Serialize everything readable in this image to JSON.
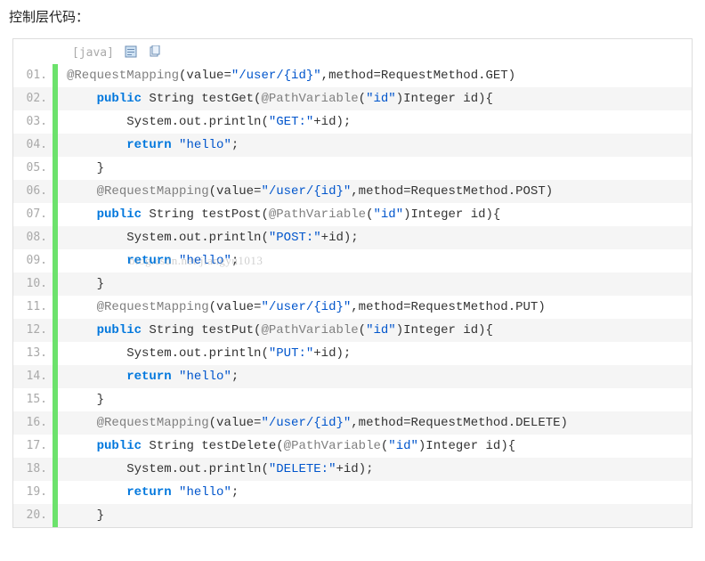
{
  "title": "控制层代码：",
  "header": {
    "lang_label": "[java]"
  },
  "watermark": "blog.csdn.net/jiangyu1013",
  "lines": [
    {
      "n": "01.",
      "indent": 0,
      "tokens": [
        {
          "c": "an",
          "t": "@RequestMapping"
        },
        {
          "c": "pl",
          "t": "(value="
        },
        {
          "c": "str",
          "t": "\"/user/{id}\""
        },
        {
          "c": "pl",
          "t": ",method=RequestMethod.GET)"
        }
      ]
    },
    {
      "n": "02.",
      "indent": 1,
      "tokens": [
        {
          "c": "kw",
          "t": "public"
        },
        {
          "c": "pl",
          "t": " String testGet("
        },
        {
          "c": "an",
          "t": "@PathVariable"
        },
        {
          "c": "pl",
          "t": "("
        },
        {
          "c": "str",
          "t": "\"id\""
        },
        {
          "c": "pl",
          "t": ")Integer id){"
        }
      ]
    },
    {
      "n": "03.",
      "indent": 2,
      "tokens": [
        {
          "c": "pl",
          "t": "System.out.println("
        },
        {
          "c": "str",
          "t": "\"GET:\""
        },
        {
          "c": "pl",
          "t": "+id);"
        }
      ]
    },
    {
      "n": "04.",
      "indent": 2,
      "tokens": [
        {
          "c": "kw",
          "t": "return"
        },
        {
          "c": "pl",
          "t": " "
        },
        {
          "c": "str",
          "t": "\"hello\""
        },
        {
          "c": "pl",
          "t": ";"
        }
      ]
    },
    {
      "n": "05.",
      "indent": 1,
      "tokens": [
        {
          "c": "pl",
          "t": "}"
        }
      ]
    },
    {
      "n": "06.",
      "indent": 1,
      "tokens": [
        {
          "c": "an",
          "t": "@RequestMapping"
        },
        {
          "c": "pl",
          "t": "(value="
        },
        {
          "c": "str",
          "t": "\"/user/{id}\""
        },
        {
          "c": "pl",
          "t": ",method=RequestMethod.POST)"
        }
      ]
    },
    {
      "n": "07.",
      "indent": 1,
      "tokens": [
        {
          "c": "kw",
          "t": "public"
        },
        {
          "c": "pl",
          "t": " String testPost("
        },
        {
          "c": "an",
          "t": "@PathVariable"
        },
        {
          "c": "pl",
          "t": "("
        },
        {
          "c": "str",
          "t": "\"id\""
        },
        {
          "c": "pl",
          "t": ")Integer id){"
        }
      ]
    },
    {
      "n": "08.",
      "indent": 2,
      "tokens": [
        {
          "c": "pl",
          "t": "System.out.println("
        },
        {
          "c": "str",
          "t": "\"POST:\""
        },
        {
          "c": "pl",
          "t": "+id);"
        }
      ]
    },
    {
      "n": "09.",
      "indent": 2,
      "watermark": true,
      "tokens": [
        {
          "c": "kw",
          "t": "return"
        },
        {
          "c": "pl",
          "t": " "
        },
        {
          "c": "str",
          "t": "\"hello\""
        },
        {
          "c": "pl",
          "t": ";"
        }
      ]
    },
    {
      "n": "10.",
      "indent": 1,
      "tokens": [
        {
          "c": "pl",
          "t": "}"
        }
      ]
    },
    {
      "n": "11.",
      "indent": 1,
      "tokens": [
        {
          "c": "an",
          "t": "@RequestMapping"
        },
        {
          "c": "pl",
          "t": "(value="
        },
        {
          "c": "str",
          "t": "\"/user/{id}\""
        },
        {
          "c": "pl",
          "t": ",method=RequestMethod.PUT)"
        }
      ]
    },
    {
      "n": "12.",
      "indent": 1,
      "tokens": [
        {
          "c": "kw",
          "t": "public"
        },
        {
          "c": "pl",
          "t": " String testPut("
        },
        {
          "c": "an",
          "t": "@PathVariable"
        },
        {
          "c": "pl",
          "t": "("
        },
        {
          "c": "str",
          "t": "\"id\""
        },
        {
          "c": "pl",
          "t": ")Integer id){"
        }
      ]
    },
    {
      "n": "13.",
      "indent": 2,
      "tokens": [
        {
          "c": "pl",
          "t": "System.out.println("
        },
        {
          "c": "str",
          "t": "\"PUT:\""
        },
        {
          "c": "pl",
          "t": "+id);"
        }
      ]
    },
    {
      "n": "14.",
      "indent": 2,
      "tokens": [
        {
          "c": "kw",
          "t": "return"
        },
        {
          "c": "pl",
          "t": " "
        },
        {
          "c": "str",
          "t": "\"hello\""
        },
        {
          "c": "pl",
          "t": ";"
        }
      ]
    },
    {
      "n": "15.",
      "indent": 1,
      "tokens": [
        {
          "c": "pl",
          "t": "}"
        }
      ]
    },
    {
      "n": "16.",
      "indent": 1,
      "tokens": [
        {
          "c": "an",
          "t": "@RequestMapping"
        },
        {
          "c": "pl",
          "t": "(value="
        },
        {
          "c": "str",
          "t": "\"/user/{id}\""
        },
        {
          "c": "pl",
          "t": ",method=RequestMethod.DELETE)"
        }
      ]
    },
    {
      "n": "17.",
      "indent": 1,
      "tokens": [
        {
          "c": "kw",
          "t": "public"
        },
        {
          "c": "pl",
          "t": " String testDelete("
        },
        {
          "c": "an",
          "t": "@PathVariable"
        },
        {
          "c": "pl",
          "t": "("
        },
        {
          "c": "str",
          "t": "\"id\""
        },
        {
          "c": "pl",
          "t": ")Integer id){"
        }
      ]
    },
    {
      "n": "18.",
      "indent": 2,
      "tokens": [
        {
          "c": "pl",
          "t": "System.out.println("
        },
        {
          "c": "str",
          "t": "\"DELETE:\""
        },
        {
          "c": "pl",
          "t": "+id);"
        }
      ]
    },
    {
      "n": "19.",
      "indent": 2,
      "tokens": [
        {
          "c": "kw",
          "t": "return"
        },
        {
          "c": "pl",
          "t": " "
        },
        {
          "c": "str",
          "t": "\"hello\""
        },
        {
          "c": "pl",
          "t": ";"
        }
      ]
    },
    {
      "n": "20.",
      "indent": 1,
      "tokens": [
        {
          "c": "pl",
          "t": "}"
        }
      ]
    }
  ]
}
